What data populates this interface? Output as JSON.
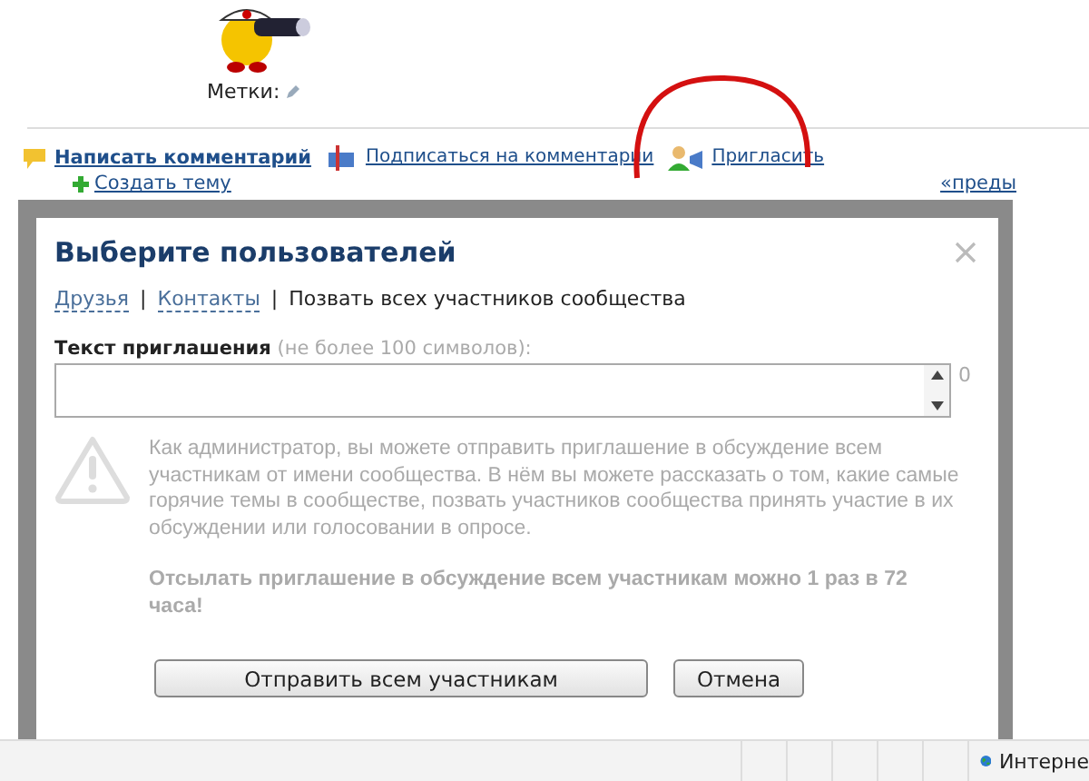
{
  "page": {
    "tags_label": "Метки:",
    "actions": [
      {
        "kind": "comment",
        "label": "Написать комментарий",
        "bold": true
      },
      {
        "kind": "subscribe",
        "label": "Подписаться на комментарии",
        "bold": false
      },
      {
        "kind": "invite",
        "label": "Пригласить",
        "bold": false
      }
    ],
    "create_topic": "Создать тему",
    "prev_link": "«преды"
  },
  "dialog": {
    "title": "Выберите пользователей",
    "tab_separator": "|",
    "tabs": [
      {
        "label": "Друзья",
        "selected": false
      },
      {
        "label": "Контакты",
        "selected": false
      },
      {
        "label": "Позвать всех участников сообщества",
        "selected": true
      }
    ],
    "field_label": "Текст приглашения",
    "field_hint": "(не более 100 символов):",
    "counter": "0",
    "info": "Как администратор, вы можете отправить приглашение в обсуждение всем участникам от имени сообщества. В нём вы можете рассказать о том, какие самые горячие темы в сообществе, позвать участников сообщества принять участие в их обсуждении или голосовании в опросе.",
    "note": "Отсылать приглашение в обсуждение всем участникам можно 1 раз в 72 часа!",
    "buttons": [
      {
        "kind": "primary",
        "label": "Отправить всем участникам"
      },
      {
        "kind": "cancel",
        "label": "Отмена"
      }
    ]
  },
  "status_bar": {
    "zone": "Интерне"
  }
}
